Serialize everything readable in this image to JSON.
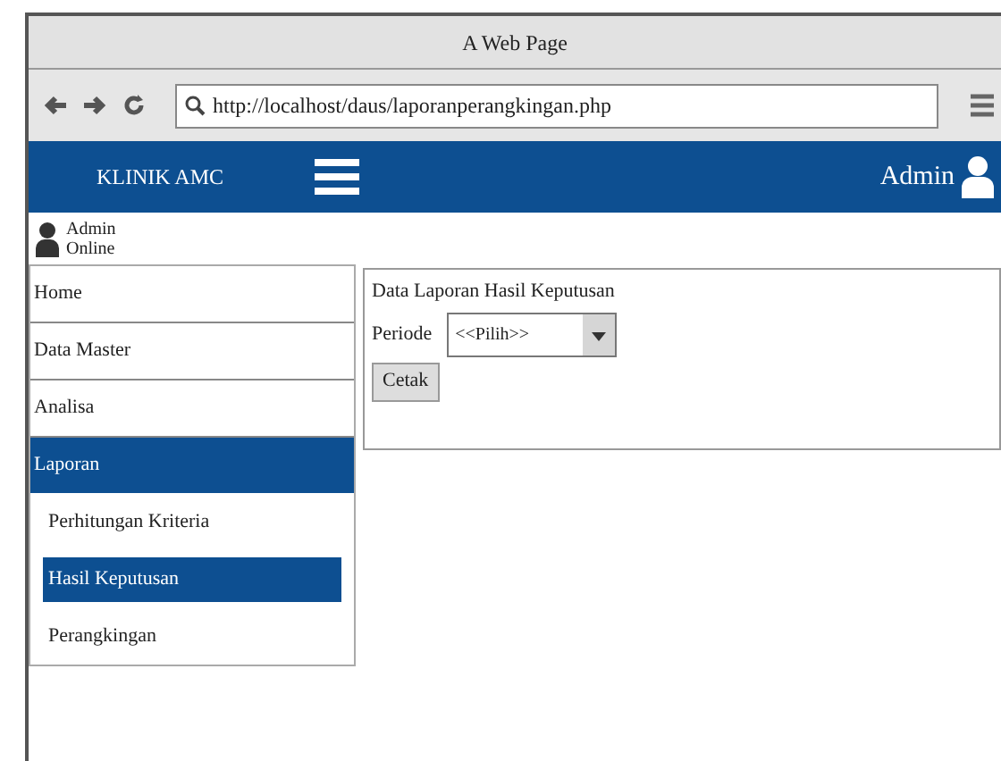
{
  "window": {
    "title": "A Web Page"
  },
  "browser": {
    "url": "http://localhost/daus/laporanperangkingan.php"
  },
  "header": {
    "brand": "KLINIK AMC",
    "user": "Admin"
  },
  "user_panel": {
    "name": "Admin",
    "status": "Online"
  },
  "sidebar": {
    "items": [
      {
        "label": "Home",
        "selected": false
      },
      {
        "label": "Data Master",
        "selected": false
      },
      {
        "label": "Analisa",
        "selected": false
      },
      {
        "label": "Laporan",
        "selected": true,
        "children": [
          {
            "label": "Perhitungan Kriteria",
            "selected": false
          },
          {
            "label": "Hasil Keputusan",
            "selected": true
          },
          {
            "label": "Perangkingan",
            "selected": false
          }
        ]
      }
    ]
  },
  "panel": {
    "title": "Data Laporan Hasil Keputusan",
    "period_label": "Periode",
    "period_value": "<<Pilih>>",
    "print_button": "Cetak"
  }
}
